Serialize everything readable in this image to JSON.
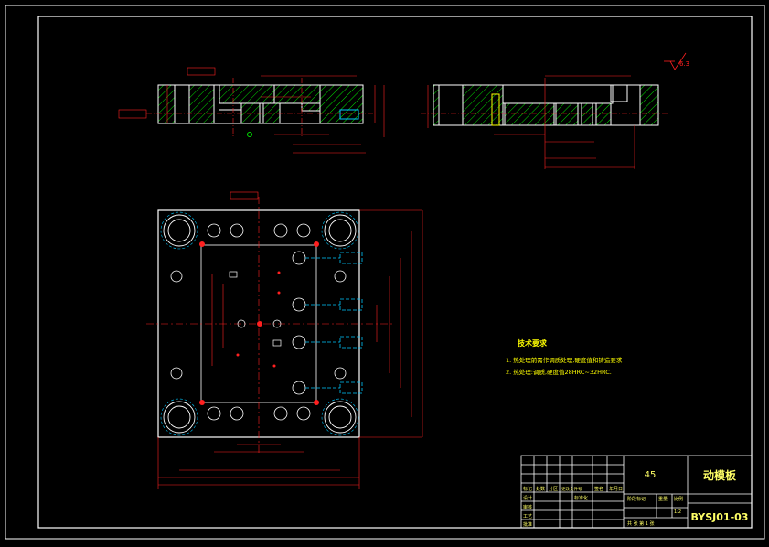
{
  "drawing": {
    "material": "45",
    "part_name": "动模板",
    "drawing_number": "BYSJ01-03",
    "roughness_symbol": "6.3"
  },
  "technical_requirements": {
    "title": "技术要求",
    "items": [
      "1. 热处理前需作调质处理,硬度值和铸造要求",
      "2. 热处理:调质,硬度值28HRC~32HRC."
    ]
  },
  "title_block": {
    "row_labels": [
      "标记",
      "设计",
      "审核",
      "工艺",
      "批准"
    ],
    "header_cells": [
      "处数",
      "分区",
      "更改文件号",
      "签名",
      "年月日"
    ],
    "standardization": "标准化",
    "stage_mark": "阶段标记",
    "weight": "重量",
    "scale": "比例",
    "scale_value": "1:2",
    "sheets": "共 张 第 1 张"
  },
  "colors": {
    "background": "#000000",
    "frame": "#ffffff",
    "outline": "#ffffff",
    "hatch": "#00e000",
    "dimension": "#ff2020",
    "hidden": "#00c8ff",
    "note_text": "#ffff00",
    "title_text": "#ffff66"
  }
}
